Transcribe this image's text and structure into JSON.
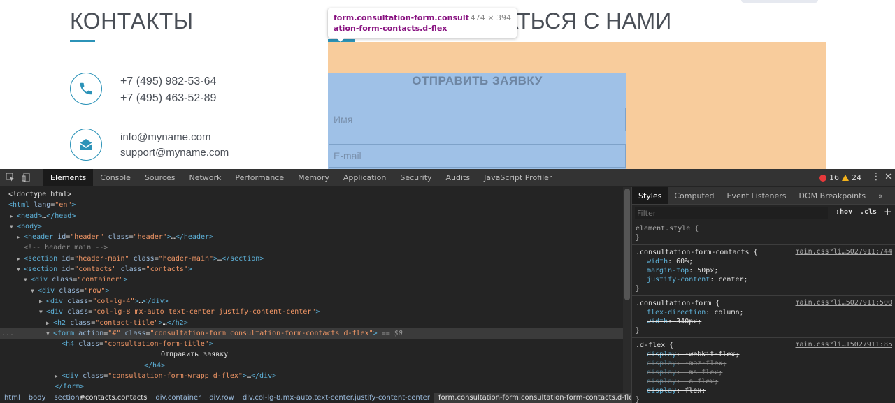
{
  "page": {
    "contacts_title": "КОНТАКТЫ",
    "contact_us_title_visible": "ВАТЬСЯ С НАМИ",
    "phones": [
      "+7 (495) 982-53-64",
      "+7 (495) 463-52-89"
    ],
    "emails": [
      "info@myname.com",
      "support@myname.com"
    ],
    "form_title": "ОТПРАВИТЬ ЗАЯВКУ",
    "name_placeholder": "Имя",
    "email_placeholder": "E-mail",
    "icons": {
      "phone": "phone-icon",
      "mail": "mail-icon"
    },
    "accent_color": "#2c93b8"
  },
  "tooltip": {
    "selector": "form.consultation-form.consultation-form-contacts.d-flex",
    "dimensions": "474 × 394"
  },
  "devtools": {
    "tabs": [
      "Elements",
      "Console",
      "Sources",
      "Network",
      "Performance",
      "Memory",
      "Application",
      "Security",
      "Audits",
      "JavaScript Profiler"
    ],
    "active_tab": "Elements",
    "errors": "16",
    "warnings": "24",
    "dom": {
      "doctype": "<!doctype html>",
      "html_tag": "html",
      "html_lang_attr": "lang",
      "html_lang_val": "\"en\"",
      "head": "head",
      "body": "body",
      "header_tag": "header",
      "header_id": "\"header\"",
      "header_class": "\"header\"",
      "comment": "<!-- header main -->",
      "section_main_id": "\"header-main\"",
      "section_main_class": "\"header-main\"",
      "section_contacts_id": "\"contacts\"",
      "section_contacts_class": "\"contacts\"",
      "container_class": "\"container\"",
      "row_class": "\"row\"",
      "col4_class": "\"col-lg-4\"",
      "col8_class": "\"col-lg-8 mx-auto text-center justify-content-center\"",
      "h2_class": "\"contact-title\"",
      "form_action": "\"#\"",
      "form_class": "\"consultation-form consultation-form-contacts d-flex\"",
      "eq0": "== $0",
      "h4_class": "\"consultation-form-title\"",
      "h4_text": "Отправить заявку",
      "wrapp_class": "\"consultation-form-wrapp d-flex\"",
      "ellipsis": "…",
      "ellipsis_dots": "..."
    },
    "breadcrumbs": [
      {
        "head": "html",
        "rest": ""
      },
      {
        "head": "body",
        "rest": ""
      },
      {
        "head": "section",
        "rest": "#contacts.contacts"
      },
      {
        "head": "div",
        "rest": ".container"
      },
      {
        "head": "div",
        "rest": ".row"
      },
      {
        "head": "div",
        "rest": ".col-lg-8.mx-auto.text-center.justify-content-center"
      },
      {
        "head": "form",
        "rest": ".consultation-form.consultation-form-contacts.d-flex"
      }
    ],
    "styles": {
      "tabs": [
        "Styles",
        "Computed",
        "Event Listeners",
        "DOM Breakpoints",
        "»"
      ],
      "filter_placeholder": "Filter",
      "hov": ":hov",
      "cls": ".cls",
      "plus": "+",
      "element_style": "element.style {",
      "close_brace": "}",
      "rule1_selector": ".consultation-form-contacts {",
      "rule1_source": "main.css?li…5027911:744",
      "rule1_decls": [
        {
          "prop": "width",
          "value": "60%;"
        },
        {
          "prop": "margin-top",
          "value": "50px;"
        },
        {
          "prop": "justify-content",
          "value": "center;"
        }
      ],
      "rule2_selector": ".consultation-form {",
      "rule2_source": "main.css?li…5027911:500",
      "rule2_decls": [
        {
          "prop": "flex-direction",
          "value": "column;"
        },
        {
          "prop": "width",
          "value": "340px;"
        }
      ],
      "rule3_selector": ".d-flex {",
      "rule3_source": "main.css?li…15027911:85",
      "rule3_decls": [
        {
          "prop": "display",
          "value": "-webkit-flex;"
        },
        {
          "prop": "display",
          "value": "-moz-flex;"
        },
        {
          "prop": "display",
          "value": "-ms-flex;"
        },
        {
          "prop": "display",
          "value": "-o-flex;"
        },
        {
          "prop": "display",
          "value": "flex;"
        }
      ]
    }
  }
}
